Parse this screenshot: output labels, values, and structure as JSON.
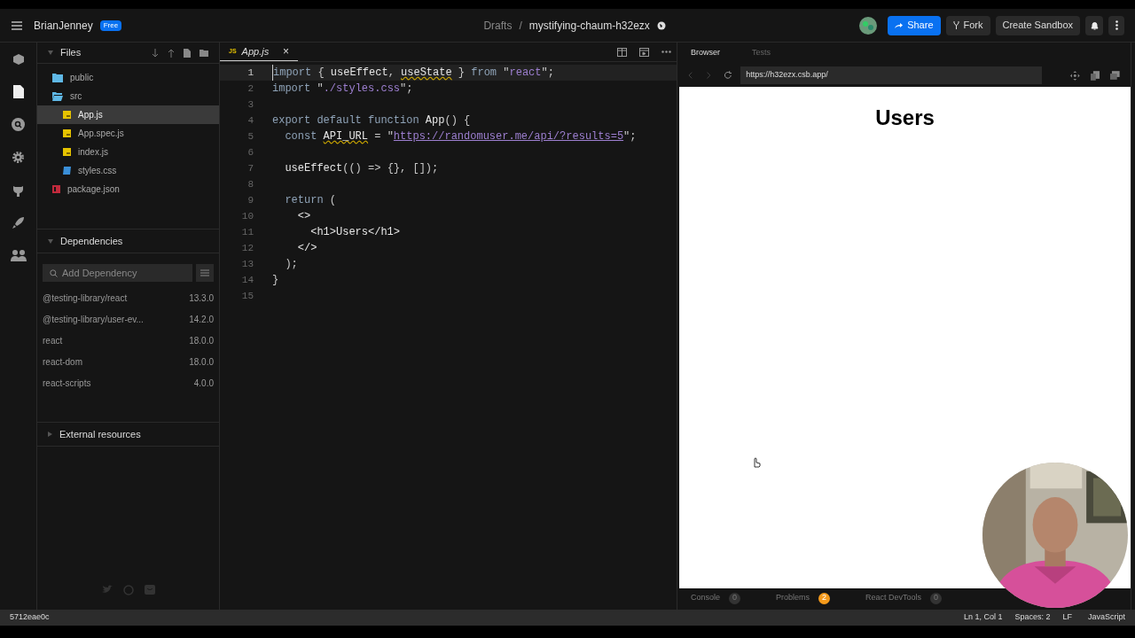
{
  "header": {
    "user": "BrianJenney",
    "plan_badge": "Free",
    "breadcrumb": {
      "folder": "Drafts",
      "separator": "/",
      "sandbox": "mystifying-chaum-h32ezx"
    },
    "buttons": [
      {
        "kind": "share",
        "label": "Share"
      },
      {
        "kind": "fork",
        "label": "Fork"
      },
      {
        "kind": "create",
        "label": "Create Sandbox"
      }
    ]
  },
  "files": {
    "title": "Files",
    "items": [
      {
        "kind": "folder",
        "label": "public",
        "expanded": false,
        "selected": false
      },
      {
        "kind": "folder",
        "label": "src",
        "expanded": true,
        "selected": false,
        "children": [
          {
            "kind": "js",
            "label": "App.js",
            "selected": true
          },
          {
            "kind": "js",
            "label": "App.spec.js",
            "selected": false
          },
          {
            "kind": "js",
            "label": "index.js",
            "selected": false
          },
          {
            "kind": "css",
            "label": "styles.css",
            "selected": false
          }
        ]
      },
      {
        "kind": "json",
        "label": "package.json",
        "selected": false
      }
    ]
  },
  "dependencies": {
    "title": "Dependencies",
    "search_placeholder": "Add Dependency",
    "items": [
      {
        "name": "@testing-library/react",
        "version": "13.3.0"
      },
      {
        "name": "@testing-library/user-ev...",
        "version": "14.2.0"
      },
      {
        "name": "react",
        "version": "18.0.0"
      },
      {
        "name": "react-dom",
        "version": "18.0.0"
      },
      {
        "name": "react-scripts",
        "version": "4.0.0"
      }
    ]
  },
  "external_resources": {
    "title": "External resources"
  },
  "editor": {
    "tab": {
      "badge": "JS",
      "label": "App.js",
      "close": "×"
    },
    "lines": [
      {
        "number": "1",
        "tokens": [
          {
            "kind": "keyword",
            "text": "import"
          },
          {
            "kind": "punct",
            "text": " { "
          },
          {
            "kind": "plain",
            "text": "useEffect"
          },
          {
            "kind": "punct",
            "text": ", "
          },
          {
            "kind": "warned",
            "text": "useState"
          },
          {
            "kind": "punct",
            "text": " } "
          },
          {
            "kind": "keyword",
            "text": "from"
          },
          {
            "kind": "punct",
            "text": " \""
          },
          {
            "kind": "string",
            "text": "react"
          },
          {
            "kind": "punct",
            "text": "\";"
          }
        ]
      },
      {
        "number": "2",
        "tokens": [
          {
            "kind": "keyword",
            "text": "import"
          },
          {
            "kind": "punct",
            "text": " \""
          },
          {
            "kind": "string",
            "text": "./styles.css"
          },
          {
            "kind": "punct",
            "text": "\";"
          }
        ]
      },
      {
        "number": "3"
      },
      {
        "number": "4",
        "tokens": [
          {
            "kind": "keyword",
            "text": "export default function"
          },
          {
            "kind": "plain",
            "text": " App"
          },
          {
            "kind": "punct",
            "text": "() {"
          }
        ]
      },
      {
        "number": "5",
        "tokens": [
          {
            "kind": "keyword",
            "text": "  const "
          },
          {
            "kind": "warned",
            "text": "API_URL"
          },
          {
            "kind": "punct",
            "text": " = \""
          },
          {
            "kind": "link",
            "text": "https://randomuser.me/api/?results=5"
          },
          {
            "kind": "punct",
            "text": "\";"
          }
        ]
      },
      {
        "number": "6"
      },
      {
        "number": "7",
        "tokens": [
          {
            "kind": "plain",
            "text": "  useEffect"
          },
          {
            "kind": "punct",
            "text": "(() => {}, []);"
          }
        ]
      },
      {
        "number": "8"
      },
      {
        "number": "9",
        "tokens": [
          {
            "kind": "keyword",
            "text": "  return"
          },
          {
            "kind": "punct",
            "text": " ("
          }
        ]
      },
      {
        "number": "10",
        "tokens": [
          {
            "kind": "plain",
            "text": "    <>"
          }
        ]
      },
      {
        "number": "11",
        "tokens": [
          {
            "kind": "plain",
            "text": "      <h1>Users</h1>"
          }
        ]
      },
      {
        "number": "12",
        "tokens": [
          {
            "kind": "plain",
            "text": "    </>"
          }
        ]
      },
      {
        "number": "13",
        "tokens": [
          {
            "kind": "punct",
            "text": "  );"
          }
        ]
      },
      {
        "number": "14",
        "tokens": [
          {
            "kind": "punct",
            "text": "}"
          }
        ]
      },
      {
        "number": "15"
      }
    ]
  },
  "preview": {
    "tabs": [
      {
        "label": "Browser",
        "selected": true
      },
      {
        "label": "Tests",
        "selected": false
      }
    ],
    "url": "https://h32ezx.csb.app/",
    "heading": "Users",
    "console_tabs": [
      {
        "label": "Console",
        "count": "0",
        "alert": false
      },
      {
        "label": "Problems",
        "count": "2",
        "alert": true
      },
      {
        "label": "React DevTools",
        "count": "0",
        "alert": false
      }
    ]
  },
  "status_bar": {
    "commit": "5712eae0c",
    "items": [
      "Ln 1, Col 1",
      "Spaces: 2",
      "LF",
      "JavaScript"
    ]
  }
}
